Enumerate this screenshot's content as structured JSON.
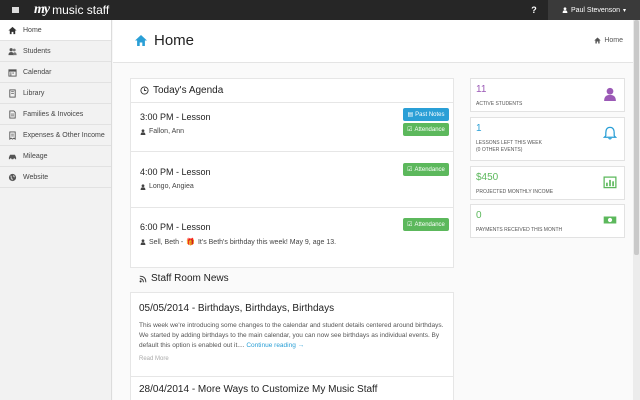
{
  "app": {
    "logo_mark": "my",
    "logo_text": "music staff",
    "help_icon": "question-icon",
    "user_name": "Paul Stevenson"
  },
  "colors": {
    "accent": "#2a9fd6",
    "success": "#5cb85c",
    "purple": "#9b59b6",
    "dark_bar": "#262626"
  },
  "sidebar": {
    "items": [
      {
        "label": "Home",
        "icon": "home-icon",
        "active": true
      },
      {
        "label": "Students",
        "icon": "users-icon"
      },
      {
        "label": "Calendar",
        "icon": "calendar-icon"
      },
      {
        "label": "Library",
        "icon": "book-icon"
      },
      {
        "label": "Families & Invoices",
        "icon": "document-icon"
      },
      {
        "label": "Expenses & Other Income",
        "icon": "receipt-icon"
      },
      {
        "label": "Mileage",
        "icon": "car-icon"
      },
      {
        "label": "Website",
        "icon": "globe-icon"
      }
    ]
  },
  "page": {
    "title": "Home",
    "breadcrumb": "Home"
  },
  "agenda": {
    "title": "Today's Agenda",
    "lessons": [
      {
        "time": "3:00 PM - Lesson",
        "student": "Fallon, Ann",
        "note": "",
        "buttons": [
          "Past Notes",
          "Attendance"
        ]
      },
      {
        "time": "4:00 PM - Lesson",
        "student": "Longo, Angiea",
        "note": "",
        "buttons": [
          "Attendance"
        ]
      },
      {
        "time": "6:00 PM - Lesson",
        "student": "Sell, Beth -",
        "note": "It's Beth's birthday this week! May 9, age 13.",
        "buttons": [
          "Attendance"
        ]
      }
    ]
  },
  "stats": [
    {
      "value": "11",
      "label": "ACTIVE STUDENTS",
      "color": "#9b59b6",
      "icon": "user-icon"
    },
    {
      "value": "1",
      "label": "LESSONS LEFT THIS WEEK",
      "sublabel": "(0 OTHER EVENTS)",
      "color": "#2a9fd6",
      "icon": "bell-icon"
    },
    {
      "value": "$450",
      "label": "PROJECTED MONTHLY INCOME",
      "color": "#5cb85c",
      "icon": "bar-chart-icon"
    },
    {
      "value": "0",
      "label": "PAYMENTS RECEIVED THIS MONTH",
      "color": "#5cb85c",
      "icon": "money-icon"
    }
  ],
  "news": {
    "title": "Staff Room News",
    "items": [
      {
        "title": "05/05/2014 - Birthdays, Birthdays, Birthdays",
        "body": "This week we're introducing some changes to the calendar and student details centered around birthdays. We started by adding birthdays to the main calendar, you can now see birthdays as individual events. By default this option is enabled out it....",
        "more": "Continue reading →",
        "read_more": "Read More"
      },
      {
        "title": "28/04/2014 - More Ways to Customize My Music Staff"
      }
    ]
  }
}
